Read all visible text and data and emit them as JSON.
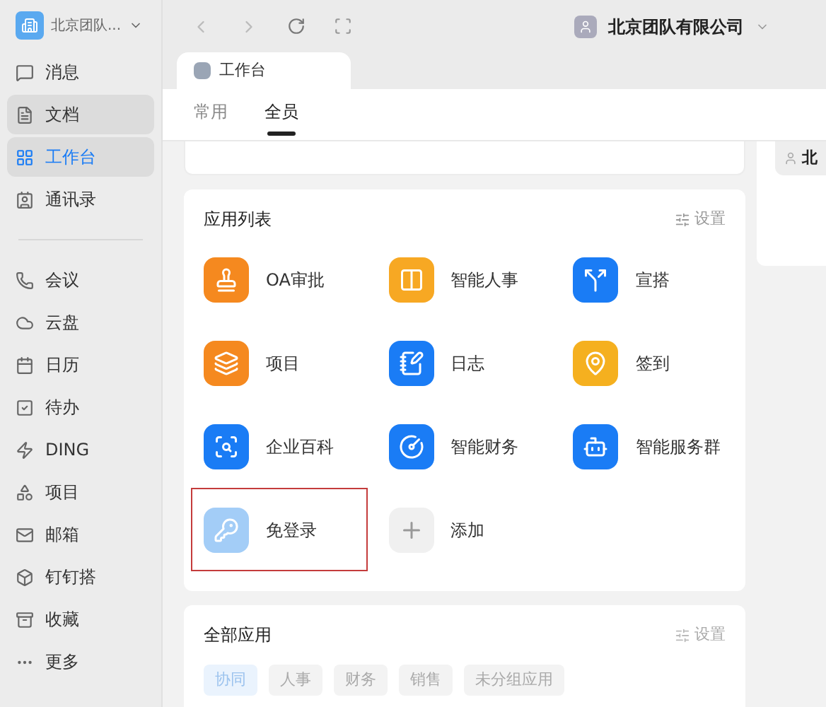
{
  "sidebar": {
    "org": "北京团队...",
    "items": [
      {
        "label": "消息",
        "selected": false,
        "hovered": false
      },
      {
        "label": "文档",
        "selected": false,
        "hovered": true
      },
      {
        "label": "工作台",
        "selected": true,
        "hovered": false
      },
      {
        "label": "通讯录",
        "selected": false,
        "hovered": false
      }
    ],
    "more_items": [
      {
        "label": "会议"
      },
      {
        "label": "云盘"
      },
      {
        "label": "日历"
      },
      {
        "label": "待办"
      },
      {
        "label": "DING"
      },
      {
        "label": "项目"
      },
      {
        "label": "邮箱"
      },
      {
        "label": "钉钉搭"
      },
      {
        "label": "收藏"
      },
      {
        "label": "更多"
      }
    ]
  },
  "topbar": {
    "company": "北京团队有限公司"
  },
  "window_tab": {
    "title": "工作台"
  },
  "tabs": [
    {
      "label": "常用",
      "selected": false
    },
    {
      "label": "全员",
      "selected": true
    }
  ],
  "right_panel": {
    "chip": "北"
  },
  "app_list": {
    "title": "应用列表",
    "settings": "设置",
    "apps": [
      {
        "kind": "app",
        "name": "OA审批",
        "color": "#f5891f",
        "highlighted": false
      },
      {
        "kind": "app",
        "name": "智能人事",
        "color": "#f7a823",
        "highlighted": false
      },
      {
        "kind": "app",
        "name": "宣搭",
        "color": "#1a7cf5",
        "highlighted": false
      },
      {
        "kind": "app",
        "name": "项目",
        "color": "#f5891f",
        "highlighted": false
      },
      {
        "kind": "app",
        "name": "日志",
        "color": "#1a7cf5",
        "highlighted": false
      },
      {
        "kind": "app",
        "name": "签到",
        "color": "#f5b01f",
        "highlighted": false
      },
      {
        "kind": "app",
        "name": "企业百科",
        "color": "#1a7cf5",
        "highlighted": false
      },
      {
        "kind": "app",
        "name": "智能财务",
        "color": "#1a7cf5",
        "highlighted": false
      },
      {
        "kind": "app",
        "name": "智能服务群",
        "color": "#1a7cf5",
        "highlighted": false
      },
      {
        "kind": "app",
        "name": "免登录",
        "color": "#a3cdf7",
        "highlighted": true
      },
      {
        "kind": "add",
        "name": "添加",
        "highlighted": false
      }
    ]
  },
  "all_apps": {
    "title": "全部应用",
    "settings": "设置",
    "categories": [
      {
        "label": "协同",
        "selected": true
      },
      {
        "label": "人事",
        "selected": false
      },
      {
        "label": "财务",
        "selected": false
      },
      {
        "label": "销售",
        "selected": false
      },
      {
        "label": "未分组应用",
        "selected": false
      }
    ]
  }
}
